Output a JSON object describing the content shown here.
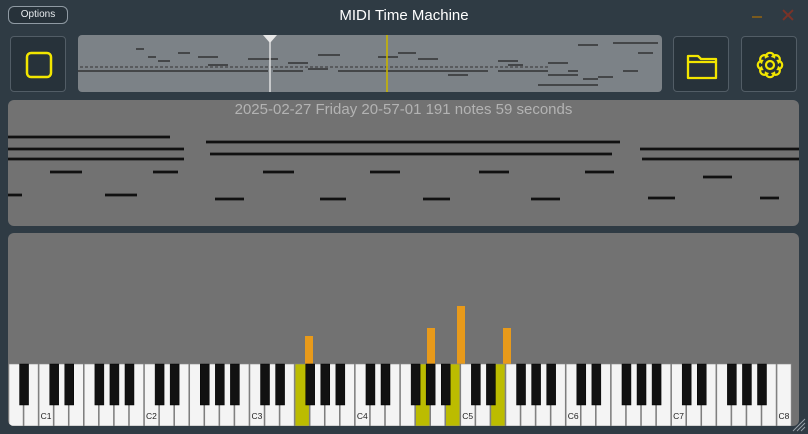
{
  "titlebar": {
    "options_label": "Options",
    "title": "MIDI Time Machine"
  },
  "toolbar": {
    "record_icon": "stop-square-icon",
    "open_icon": "folder-icon",
    "settings_icon": "gear-icon",
    "accent_color": "#f2e600"
  },
  "recording": {
    "caption": "2025-02-27 Friday 20-57-01 191 notes 59 seconds"
  },
  "keyboard": {
    "octave_labels": [
      "C1",
      "C2",
      "C3",
      "C4",
      "C5",
      "C6",
      "C7",
      "C8"
    ],
    "active_key_color": "#bcbc00",
    "velocity_bar_color": "#e89a1a"
  }
}
